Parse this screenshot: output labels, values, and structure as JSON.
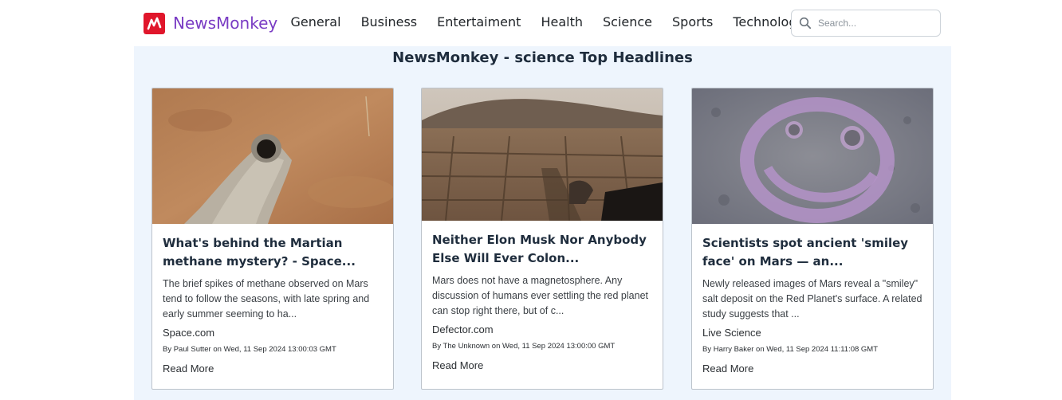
{
  "brand": {
    "name": "NewsMonkey",
    "logo_icon": "newsmonkey-logo-icon",
    "logo_color": "#e0162b",
    "accent_color": "#7a3cc4"
  },
  "nav": {
    "items": [
      {
        "label": "General"
      },
      {
        "label": "Business"
      },
      {
        "label": "Entertaiment"
      },
      {
        "label": "Health"
      },
      {
        "label": "Science"
      },
      {
        "label": "Sports"
      },
      {
        "label": "Technology"
      }
    ]
  },
  "search": {
    "placeholder": "Search...",
    "value": "",
    "icon": "search-icon"
  },
  "page": {
    "title": "NewsMonkey - science Top Headlines"
  },
  "articles": [
    {
      "title": "What's behind the Martian methane mystery? - Space...",
      "description": "The brief spikes of methane observed on Mars tend to follow the seasons, with late spring and early summer seeming to ha...",
      "source": "Space.com",
      "byline": "By Paul Sutter on Wed, 11 Sep 2024 13:00:03 GMT",
      "read_more": "Read More",
      "image_alt": "Drill hole in Martian rock"
    },
    {
      "title": "Neither Elon Musk Nor Anybody Else Will Ever Colon...",
      "description": "Mars does not have a magnetosphere. Any discussion of humans ever settling the red planet can stop right there, but of c...",
      "source": "Defector.com",
      "byline": "By The Unknown on Wed, 11 Sep 2024 13:00:00 GMT",
      "read_more": "Read More",
      "image_alt": "Martian landscape with rover shadow"
    },
    {
      "title": "Scientists spot ancient 'smiley face' on Mars — an...",
      "description": "Newly released images of Mars reveal a \"smiley\" salt deposit on the Red Planet's surface. A related study suggests that ...",
      "source": "Live Science",
      "byline": "By Harry Baker on Wed, 11 Sep 2024 11:11:08 GMT",
      "read_more": "Read More",
      "image_alt": "Smiley face salt deposit on Mars"
    }
  ]
}
